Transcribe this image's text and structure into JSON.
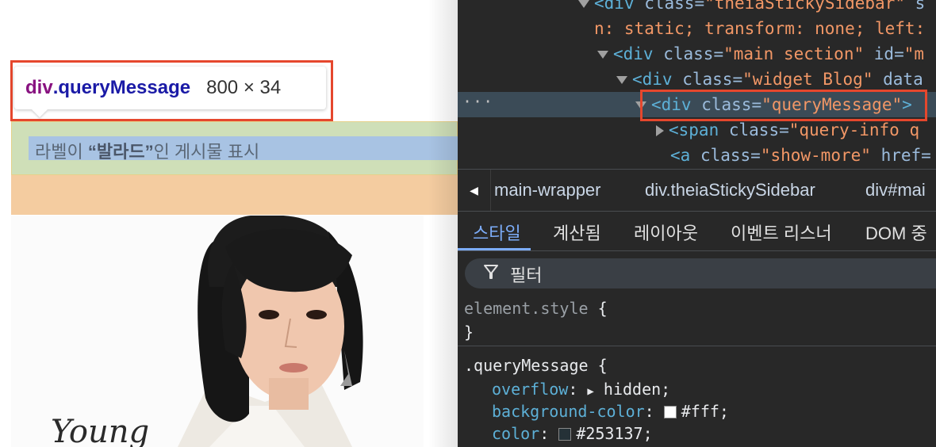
{
  "tooltip": {
    "tag": "div",
    "class_name": ".queryMessage",
    "size": "800 × 34"
  },
  "page": {
    "query_prefix": "라벨이 ",
    "query_label": "“발라드”",
    "query_suffix": "인 게시물 표시"
  },
  "dom_tree": {
    "lines": [
      {
        "tag_open": "<div",
        "attr": "class",
        "value": "\"theiaStickySidebar\"",
        "rest": " s"
      },
      {
        "text": "n: static; transform: none; left:"
      },
      {
        "tag_open": "<div",
        "attr": "class",
        "value": "\"main section\"",
        "attr2": "id",
        "value2": "\"m"
      },
      {
        "tag_open": "<div",
        "attr": "class",
        "value": "\"widget Blog\"",
        "attr2": "data"
      },
      {
        "tag_open": "<div",
        "attr": "class",
        "value": "\"queryMessage\"",
        "tag_close": ">"
      },
      {
        "tag_open": "<span",
        "attr": "class",
        "value": "\"query-info q"
      },
      {
        "tag_open": "<a",
        "attr": "class",
        "value": "\"show-more\"",
        "attr2": "href="
      }
    ],
    "selected_marker": "···"
  },
  "breadcrumbs": [
    "main-wrapper",
    "div.theiaStickySidebar",
    "div#mai"
  ],
  "tabs": [
    "스타일",
    "계산됨",
    "레이아웃",
    "이벤트 리스너",
    "DOM 중"
  ],
  "filter": {
    "placeholder": "필터"
  },
  "styles": {
    "element_style_selector": "element.style",
    "open_brace": "{",
    "close_brace": "}",
    "rule_selector": ".queryMessage",
    "properties": [
      {
        "name": "overflow",
        "value": "hidden"
      },
      {
        "name": "background-color",
        "value": "#fff",
        "swatch": "#ffffff"
      },
      {
        "name": "color",
        "value": "#253137",
        "swatch": "#253137"
      }
    ]
  },
  "colors": {
    "highlight_red": "#e5472d",
    "devtools_bg": "#282828",
    "active_tab": "#7cacf8"
  }
}
